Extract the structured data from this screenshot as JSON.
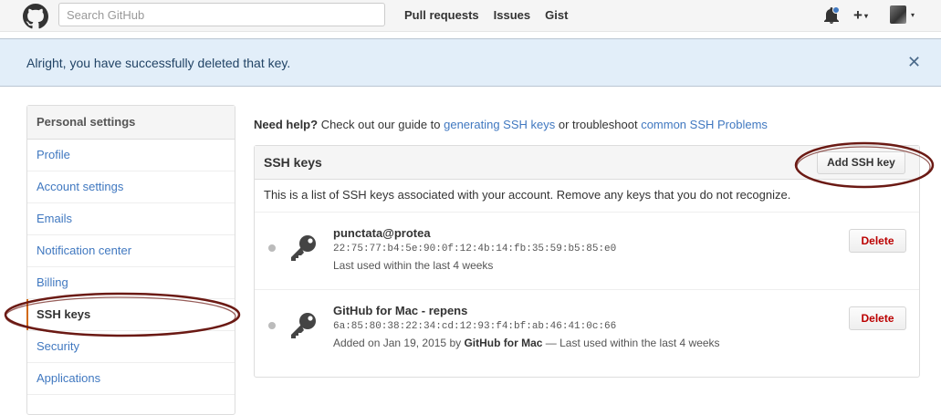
{
  "header": {
    "search_placeholder": "Search GitHub",
    "nav": [
      "Pull requests",
      "Issues",
      "Gist"
    ]
  },
  "flash": {
    "message": "Alright, you have successfully deleted that key."
  },
  "sidebar": {
    "heading": "Personal settings",
    "items": [
      {
        "label": "Profile"
      },
      {
        "label": "Account settings"
      },
      {
        "label": "Emails"
      },
      {
        "label": "Notification center"
      },
      {
        "label": "Billing"
      },
      {
        "label": "SSH keys",
        "active": true
      },
      {
        "label": "Security"
      },
      {
        "label": "Applications"
      }
    ]
  },
  "help": {
    "prefix": "Need help?",
    "text1": " Check out our guide to ",
    "link1": "generating SSH keys",
    "text2": " or troubleshoot ",
    "link2": "common SSH Problems"
  },
  "ssh": {
    "title": "SSH keys",
    "add_button": "Add SSH key",
    "description": "This is a list of SSH keys associated with your account. Remove any keys that you do not recognize.",
    "keys": [
      {
        "title": "punctata@protea",
        "fingerprint": "22:75:77:b4:5e:90:0f:12:4b:14:fb:35:59:b5:85:e0",
        "meta_prefix": "Last used within the last 4 weeks",
        "meta_bold": "",
        "meta_suffix": "",
        "delete_label": "Delete"
      },
      {
        "title": "GitHub for Mac - repens",
        "fingerprint": "6a:85:80:38:22:34:cd:12:93:f4:bf:ab:46:41:0c:66",
        "meta_prefix": "Added on Jan 19, 2015 by ",
        "meta_bold": "GitHub for Mac",
        "meta_suffix": " — Last used within the last 4 weeks",
        "delete_label": "Delete"
      }
    ]
  },
  "colors": {
    "link": "#4078c0",
    "flash_bg": "#e2eef9",
    "active_marker": "#d26911",
    "annotation": "#6b1a14"
  },
  "icons": [
    "github-logo-icon",
    "bell-icon",
    "plus-icon",
    "chevron-down-icon",
    "close-icon",
    "key-icon"
  ]
}
